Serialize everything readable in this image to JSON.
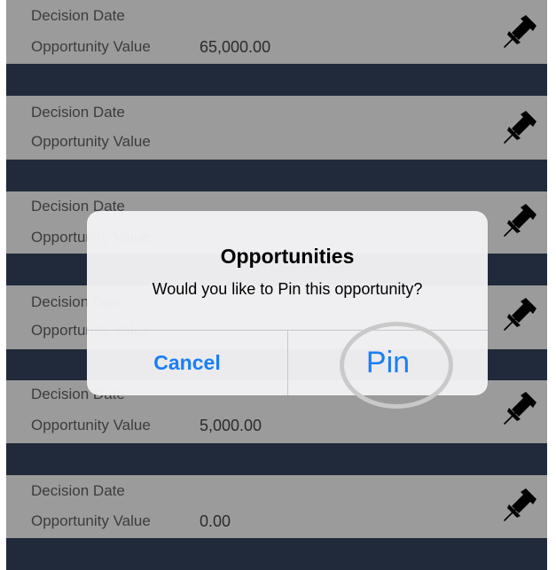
{
  "colors": {
    "card": "#9b9b9b",
    "separator": "#202a3a",
    "accent": "#1a7ef5",
    "highlight_ring": "#c9c9c9"
  },
  "rows": [
    {
      "decision_label": "Decision Date",
      "value_label": "Opportunity Value",
      "value": "65,000.00",
      "icon": "pushpin-icon"
    },
    {
      "decision_label": "Decision Date",
      "value_label": "Opportunity Value",
      "value": "",
      "icon": "pushpin-icon"
    },
    {
      "decision_label": "Decision Date",
      "value_label": "Opportunity Value",
      "value": "",
      "icon": "pushpin-icon"
    },
    {
      "decision_label": "Decision Date",
      "value_label": "Opportunity Value",
      "value": "",
      "icon": "pushpin-icon"
    },
    {
      "decision_label": "Decision Date",
      "value_label": "Opportunity Value",
      "value": "5,000.00",
      "icon": "pushpin-icon"
    },
    {
      "decision_label": "Decision Date",
      "value_label": "Opportunity Value",
      "value": "0.00",
      "icon": "pushpin-icon"
    }
  ],
  "dialog": {
    "title": "Opportunities",
    "message": "Would you like to Pin this opportunity?",
    "cancel_label": "Cancel",
    "pin_label": "Pin"
  }
}
